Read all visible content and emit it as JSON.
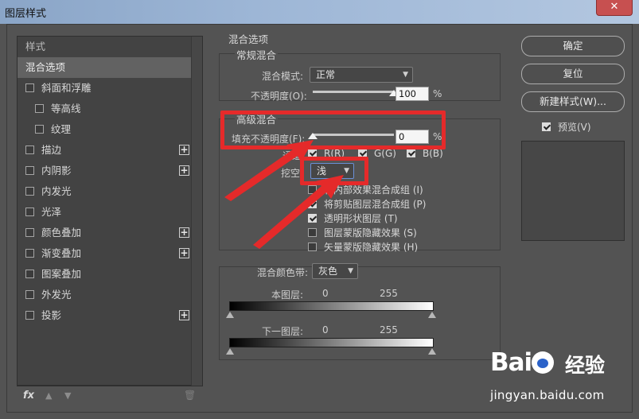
{
  "window": {
    "title": "图层样式",
    "close_label": "✕"
  },
  "left_panel": {
    "header": "样式",
    "items": [
      {
        "label": "混合选项",
        "selected": true,
        "checkbox": false,
        "plus": false
      },
      {
        "label": "斜面和浮雕",
        "checkbox": true,
        "checked": false,
        "plus": false
      },
      {
        "label": "等高线",
        "checkbox": true,
        "checked": false,
        "indent": true,
        "plus": false
      },
      {
        "label": "纹理",
        "checkbox": true,
        "checked": false,
        "indent": true,
        "plus": false
      },
      {
        "label": "描边",
        "checkbox": true,
        "checked": false,
        "plus": true
      },
      {
        "label": "内阴影",
        "checkbox": true,
        "checked": false,
        "plus": true
      },
      {
        "label": "内发光",
        "checkbox": true,
        "checked": false,
        "plus": false
      },
      {
        "label": "光泽",
        "checkbox": true,
        "checked": false,
        "plus": false
      },
      {
        "label": "颜色叠加",
        "checkbox": true,
        "checked": false,
        "plus": true
      },
      {
        "label": "渐变叠加",
        "checkbox": true,
        "checked": false,
        "plus": true
      },
      {
        "label": "图案叠加",
        "checkbox": true,
        "checked": false,
        "plus": false
      },
      {
        "label": "外发光",
        "checkbox": true,
        "checked": false,
        "plus": false
      },
      {
        "label": "投影",
        "checkbox": true,
        "checked": false,
        "plus": true
      }
    ],
    "footer": {
      "fx_label": "fx",
      "up": "▲",
      "down": "▼",
      "trash": "🗑"
    }
  },
  "blending": {
    "section_title": "混合选项",
    "general": {
      "title": "常规混合",
      "blend_mode_label": "混合模式:",
      "blend_mode_value": "正常",
      "opacity_label": "不透明度(O):",
      "opacity_value": "100",
      "opacity_fraction": 1.0,
      "pct": "%"
    },
    "advanced": {
      "title": "高级混合",
      "fill_opacity_label": "填充不透明度(F):",
      "fill_opacity_value": "0",
      "fill_opacity_fraction": 0.0,
      "pct": "%",
      "channels_label": "通道:",
      "channel_r": "R(R)",
      "channel_g": "G(G)",
      "channel_b": "B(B)",
      "knockout_label": "挖空:",
      "knockout_value": "浅",
      "options": [
        {
          "label": "将内部效果混合成组 (I)",
          "checked": false
        },
        {
          "label": "将剪贴图层混合成组 (P)",
          "checked": true
        },
        {
          "label": "透明形状图层 (T)",
          "checked": true
        },
        {
          "label": "图层蒙版隐藏效果 (S)",
          "checked": false
        },
        {
          "label": "矢量蒙版隐藏效果 (H)",
          "checked": false
        }
      ]
    },
    "blend_if": {
      "label": "混合颜色带:",
      "value": "灰色",
      "this_layer": {
        "label": "本图层:",
        "low": "0",
        "high": "255"
      },
      "underlying": {
        "label": "下一图层:",
        "low": "0",
        "high": "255"
      }
    }
  },
  "buttons": {
    "ok": "确定",
    "reset": "复位",
    "new_style": "新建样式(W)...",
    "preview_label": "预览(V)",
    "preview_checked": true
  },
  "watermark": {
    "brand_left": "Bai",
    "brand_right": "经验",
    "url": "jingyan.baidu.com"
  },
  "colors": {
    "panel_bg": "#535353",
    "list_bg": "#434343",
    "annotation_red": "#e52a2a"
  }
}
